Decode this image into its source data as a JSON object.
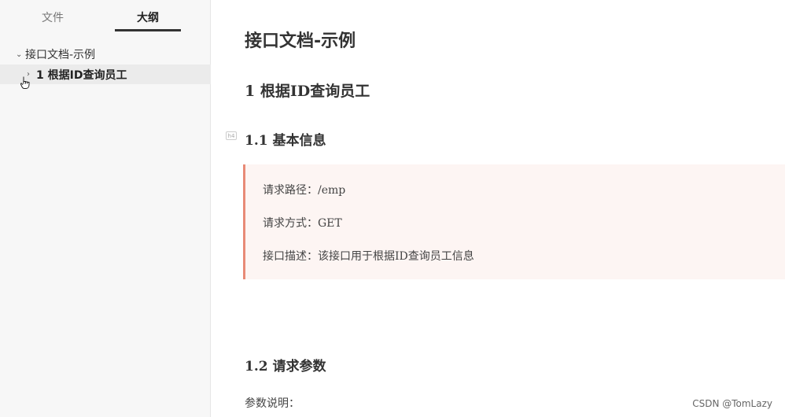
{
  "sidebar": {
    "tabs": [
      {
        "label": "文件"
      },
      {
        "label": "大纲"
      }
    ],
    "outline": {
      "root": {
        "chevron": "⌄",
        "label": "接口文档-示例"
      },
      "child": {
        "chevron": "›",
        "label": "1 根据ID查询员工"
      }
    }
  },
  "main": {
    "doc_title": "接口文档-示例",
    "h1": "1 根据ID查询员工",
    "section_basic": {
      "heading": "1.1 基本信息",
      "marker": "h4",
      "lines": [
        "请求路径：/emp",
        "请求方式：GET",
        "接口描述：该接口用于根据ID查询员工信息"
      ]
    },
    "section_params": {
      "heading": "1.2 请求参数",
      "desc": "参数说明："
    }
  },
  "watermark": "CSDN @TomLazy",
  "colors": {
    "quote_bg": "#fdf5f3",
    "quote_border": "#e88a76",
    "sidebar_bg": "#f7f7f7",
    "selected_item_bg": "#ebebeb"
  }
}
